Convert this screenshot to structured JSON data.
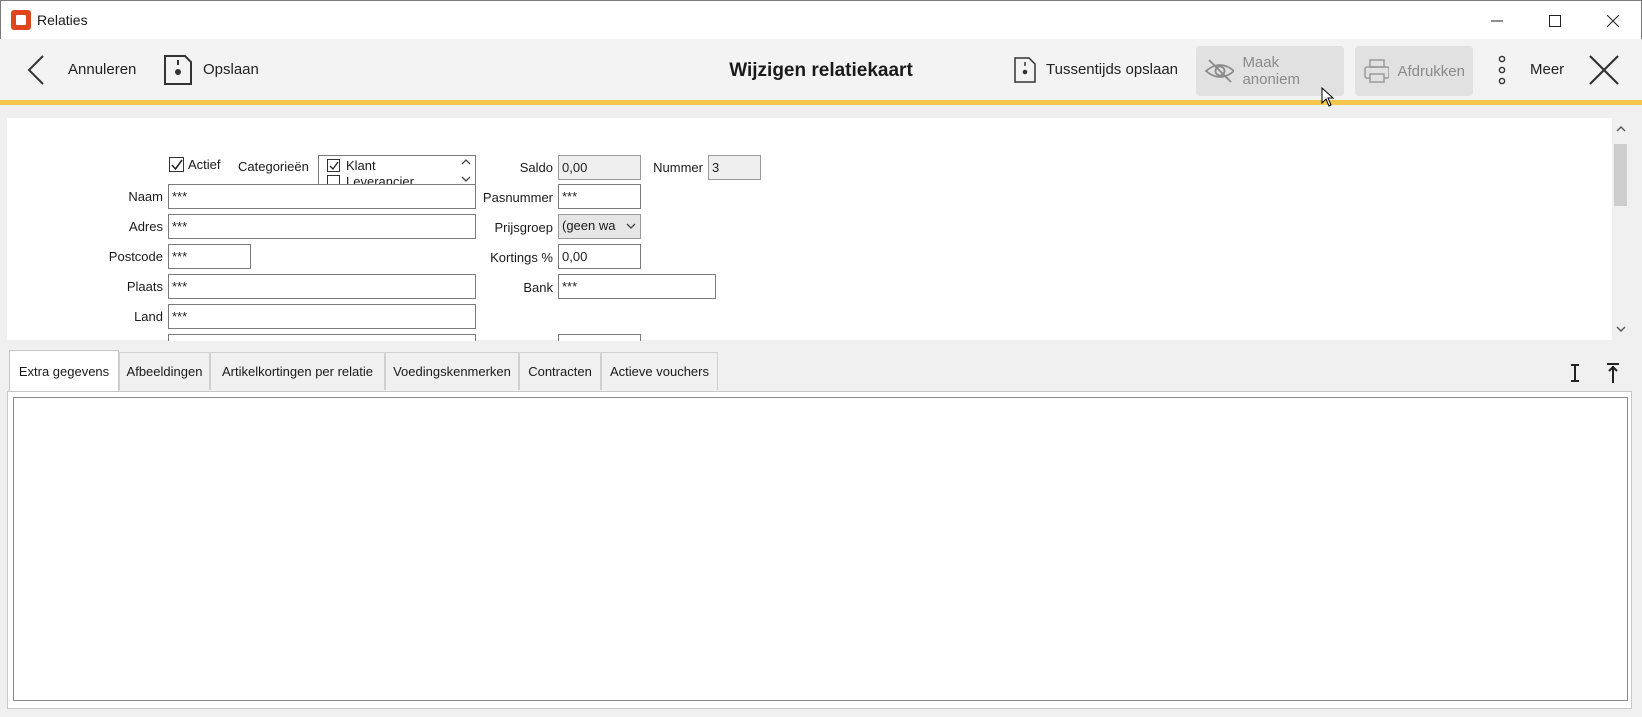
{
  "window": {
    "title": "Relaties"
  },
  "toolbar": {
    "cancel_label": "Annuleren",
    "save_label": "Opslaan",
    "page_title": "Wijzigen relatiekaart",
    "interim_save_label": "Tussentijds opslaan",
    "anonymize_label": "Maak anoniem",
    "print_label": "Afdrukken",
    "more_label": "Meer"
  },
  "form": {
    "active_label": "Actief",
    "active_checked": true,
    "categories_label": "Categorieën",
    "categories": [
      {
        "label": "Klant",
        "checked": true
      },
      {
        "label": "Leverancier",
        "checked": false
      }
    ],
    "name_label": "Naam",
    "name_value": "***",
    "address_label": "Adres",
    "address_value": "***",
    "postcode_label": "Postcode",
    "postcode_value": "***",
    "city_label": "Plaats",
    "city_value": "***",
    "country_label": "Land",
    "country_value": "***",
    "balance_label": "Saldo",
    "balance_value": "0,00",
    "number_label": "Nummer",
    "number_value": "3",
    "pass_label": "Pasnummer",
    "pass_value": "***",
    "price_group_label": "Prijsgroep",
    "price_group_value": "(geen wa",
    "discount_label": "Kortings %",
    "discount_value": "0,00",
    "bank_label": "Bank",
    "bank_value": "***"
  },
  "tabs": [
    {
      "label": "Extra gegevens",
      "active": true
    },
    {
      "label": "Afbeeldingen",
      "active": false
    },
    {
      "label": "Artikelkortingen per relatie",
      "active": false
    },
    {
      "label": "Voedingskenmerken",
      "active": false
    },
    {
      "label": "Contracten",
      "active": false
    },
    {
      "label": "Actieve vouchers",
      "active": false
    }
  ],
  "colors": {
    "accent": "#f5c84c",
    "logo": "#e0461d"
  }
}
